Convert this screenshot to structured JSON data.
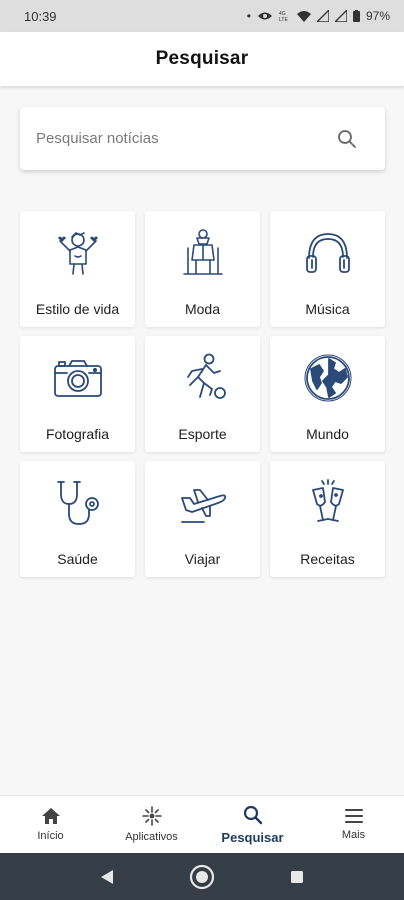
{
  "status_bar": {
    "time": "10:39",
    "battery": "97%"
  },
  "header": {
    "title": "Pesquisar"
  },
  "search": {
    "placeholder": "Pesquisar notícias"
  },
  "categories": [
    {
      "label": "Estilo de vida",
      "icon": "person-heart-icon"
    },
    {
      "label": "Moda",
      "icon": "fashion-mannequin-icon"
    },
    {
      "label": "Música",
      "icon": "headphones-icon"
    },
    {
      "label": "Fotografia",
      "icon": "camera-icon"
    },
    {
      "label": "Esporte",
      "icon": "soccer-player-icon"
    },
    {
      "label": "Mundo",
      "icon": "globe-icon"
    },
    {
      "label": "Saúde",
      "icon": "stethoscope-icon"
    },
    {
      "label": "Viajar",
      "icon": "airplane-icon"
    },
    {
      "label": "Receitas",
      "icon": "champagne-toast-icon"
    }
  ],
  "bottom_nav": [
    {
      "label": "Início",
      "icon": "home-icon"
    },
    {
      "label": "Aplicativos",
      "icon": "sparkle-icon"
    },
    {
      "label": "Pesquisar",
      "icon": "search-icon",
      "active": true
    },
    {
      "label": "Mais",
      "icon": "menu-icon"
    }
  ],
  "colors": {
    "accent": "#1f3a5f",
    "icon_stroke": "#2b4a78"
  }
}
